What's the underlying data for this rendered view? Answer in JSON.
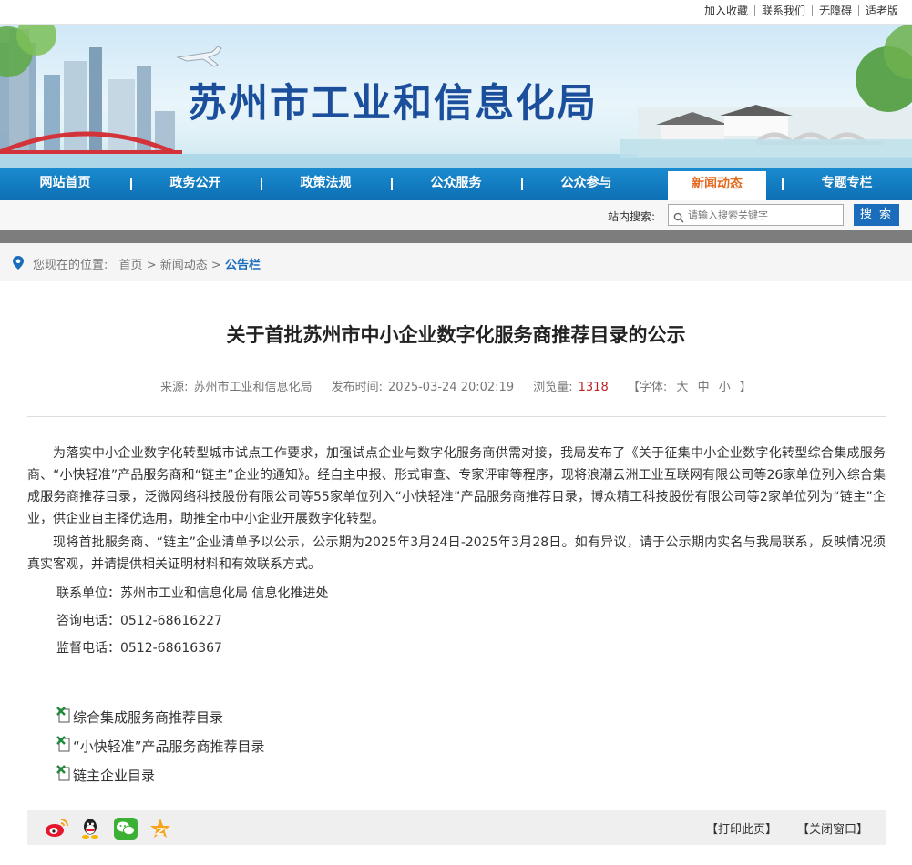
{
  "toplinks": [
    "加入收藏",
    "联系我们",
    "无障碍",
    "适老版"
  ],
  "site": {
    "title": "苏州市工业和信息化局"
  },
  "nav": {
    "items": [
      "网站首页",
      "政务公开",
      "政策法规",
      "公众服务",
      "公众参与",
      "新闻动态",
      "专题专栏"
    ],
    "active": "新闻动态"
  },
  "search": {
    "label": "站内搜索:",
    "placeholder": "请输入搜索关键字",
    "button": "搜 索"
  },
  "breadcrumb": {
    "prefix": "您现在的位置:",
    "home": "首页",
    "sep": ">",
    "section": "新闻动态",
    "current": "公告栏"
  },
  "article": {
    "title": "关于首批苏州市中小企业数字化服务商推荐目录的公示",
    "source_label": "来源:",
    "source": "苏州市工业和信息化局",
    "date_label": "发布时间:",
    "date": "2025-03-24 20:02:19",
    "views_label": "浏览量:",
    "views": "1318",
    "font_label": "【字体:",
    "font_large": "大",
    "font_medium": "中",
    "font_small": "小",
    "font_end": "】",
    "paragraphs": [
      "为落实中小企业数字化转型城市试点工作要求，加强试点企业与数字化服务商供需对接，我局发布了《关于征集中小企业数字化转型综合集成服务商、“小快轻准”产品服务商和“链主”企业的通知》。经自主申报、形式审查、专家评审等程序，现将浪潮云洲工业互联网有限公司等26家单位列入综合集成服务商推荐目录，泛微网络科技股份有限公司等55家单位列入“小快轻准”产品服务商推荐目录，博众精工科技股份有限公司等2家单位列为“链主”企业，供企业自主择优选用，助推全市中小企业开展数字化转型。",
      "现将首批服务商、“链主”企业清单予以公示，公示期为2025年3月24日-2025年3月28日。如有异议，请于公示期内实名与我局联系，反映情况须真实客观，并请提供相关证明材料和有效联系方式。"
    ],
    "contacts": [
      "联系单位：苏州市工业和信息化局 信息化推进处",
      "咨询电话：0512-68616227",
      "监督电话：0512-68616367"
    ],
    "attachments": [
      "综合集成服务商推荐目录",
      "“小快轻准”产品服务商推荐目录",
      "链主企业目录"
    ]
  },
  "share_icons": [
    "weibo-icon",
    "qq-icon",
    "wechat-icon",
    "favorite-star-icon"
  ],
  "actions": {
    "print": "【打印此页】",
    "close": "【关闭窗口】"
  },
  "colors": {
    "nav": "#1478c0",
    "active_tab_text": "#e2691f",
    "title_blue": "#1b4f9c",
    "search_button": "#1b6dbb"
  }
}
